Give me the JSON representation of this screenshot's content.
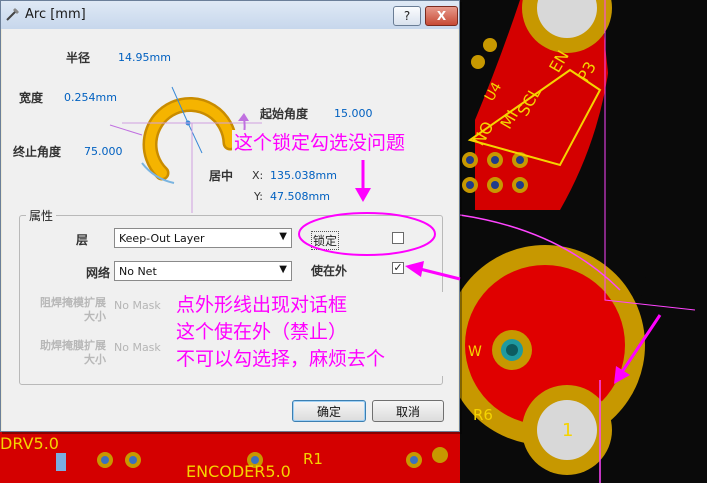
{
  "window": {
    "title": "Arc [mm]",
    "help_label": "?",
    "close_label": "X"
  },
  "arc": {
    "radius_label": "半径",
    "radius_value": "14.95mm",
    "width_label": "宽度",
    "width_value": "0.254mm",
    "start_angle_label": "起始角度",
    "start_angle_value": "15.000",
    "end_angle_label": "终止角度",
    "end_angle_value": "75.000",
    "center_label": "居中",
    "x_label": "X:",
    "x_value": "135.038mm",
    "y_label": "Y:",
    "y_value": "47.508mm"
  },
  "properties": {
    "group_label": "属性",
    "layer_label": "层",
    "layer_value": "Keep-Out Layer",
    "net_label": "网络",
    "net_value": "No Net",
    "lock_label": "锁定",
    "lock_checked": false,
    "keepout_label": "使在外",
    "keepout_checked": true,
    "solder_mask_label": "阻焊掩模扩展大小",
    "solder_mask_value": "No Mask",
    "paste_mask_label": "助焊掩膜扩展大小",
    "paste_mask_value": "No Mask"
  },
  "buttons": {
    "ok": "确定",
    "cancel": "取消"
  },
  "annotations": {
    "lock_note": "这个锁定勾选没问题",
    "keepout_note_1": "点外形线出现对话框",
    "keepout_note_2": "这个使在外（禁止）",
    "keepout_note_3": "不可以勾选择，麻烦去个"
  },
  "pcb_labels": {
    "p3": "P3",
    "en": "EN",
    "scl": "SCL",
    "mi": "MI",
    "no": "NO",
    "u4": "U4",
    "pad_1": "1",
    "w": "W",
    "r6": "R6",
    "r1": "R1",
    "drv": "DRV5.0",
    "encoder": "ENCODER5.0"
  },
  "colors": {
    "annotation": "#ff00ff",
    "copper": "#e00000",
    "silkscreen": "#f5d400",
    "pad": "#c8a000"
  }
}
